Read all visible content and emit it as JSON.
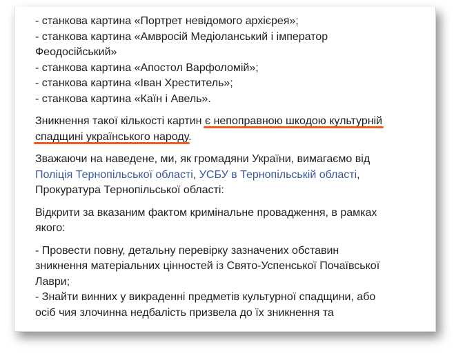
{
  "post": {
    "list_items": [
      "- станкова картина «Портрет невідомого архієрея»;",
      "- станкова картина «Амвросій Медіоланський і імператор",
      "Феодосійський»",
      "- станкова картина «Апостол Варфоломій»;",
      "- станкова картина «Іван Хреститель»;",
      "- станкова картина «Каїн і Авель»."
    ],
    "paragraph_loss": {
      "line1_start": "Зникнення такої кількості картин ",
      "line1_highlight": "є непоправною шкодою культурній",
      "line2_highlight": "спадщині українського народу",
      "line2_end": "."
    },
    "paragraph_demand": {
      "line1": "Зважаючи на наведене, ми, як громадяни України, вимагаємо від",
      "link1": "Поліція Тернопільської області",
      "sep": ", ",
      "link2": "УСБУ в Тернопільській області",
      "tail": ",",
      "line3": "Прокуратура Тернопільської області:"
    },
    "paragraph_open": {
      "line1": "Відкрити за вказаним фактом кримінальне провадження, в рамках",
      "line2": "якого:"
    },
    "paragraph_actions": {
      "line1": "- Провести повну, детальну перевірку зазначених обставин",
      "line2": "зникнення матеріальних цінностей із Свято-Успенської Почаївської",
      "line3": "Лаври;",
      "line4": "- Знайти винних у викраденні предметів культурної спадщини, або",
      "line5": "осіб чия злочинна недбалість призвела до їх зникнення та"
    }
  },
  "colors": {
    "text": "#1c1e21",
    "link": "#385898",
    "highlight_underline": "#f05a1e"
  }
}
